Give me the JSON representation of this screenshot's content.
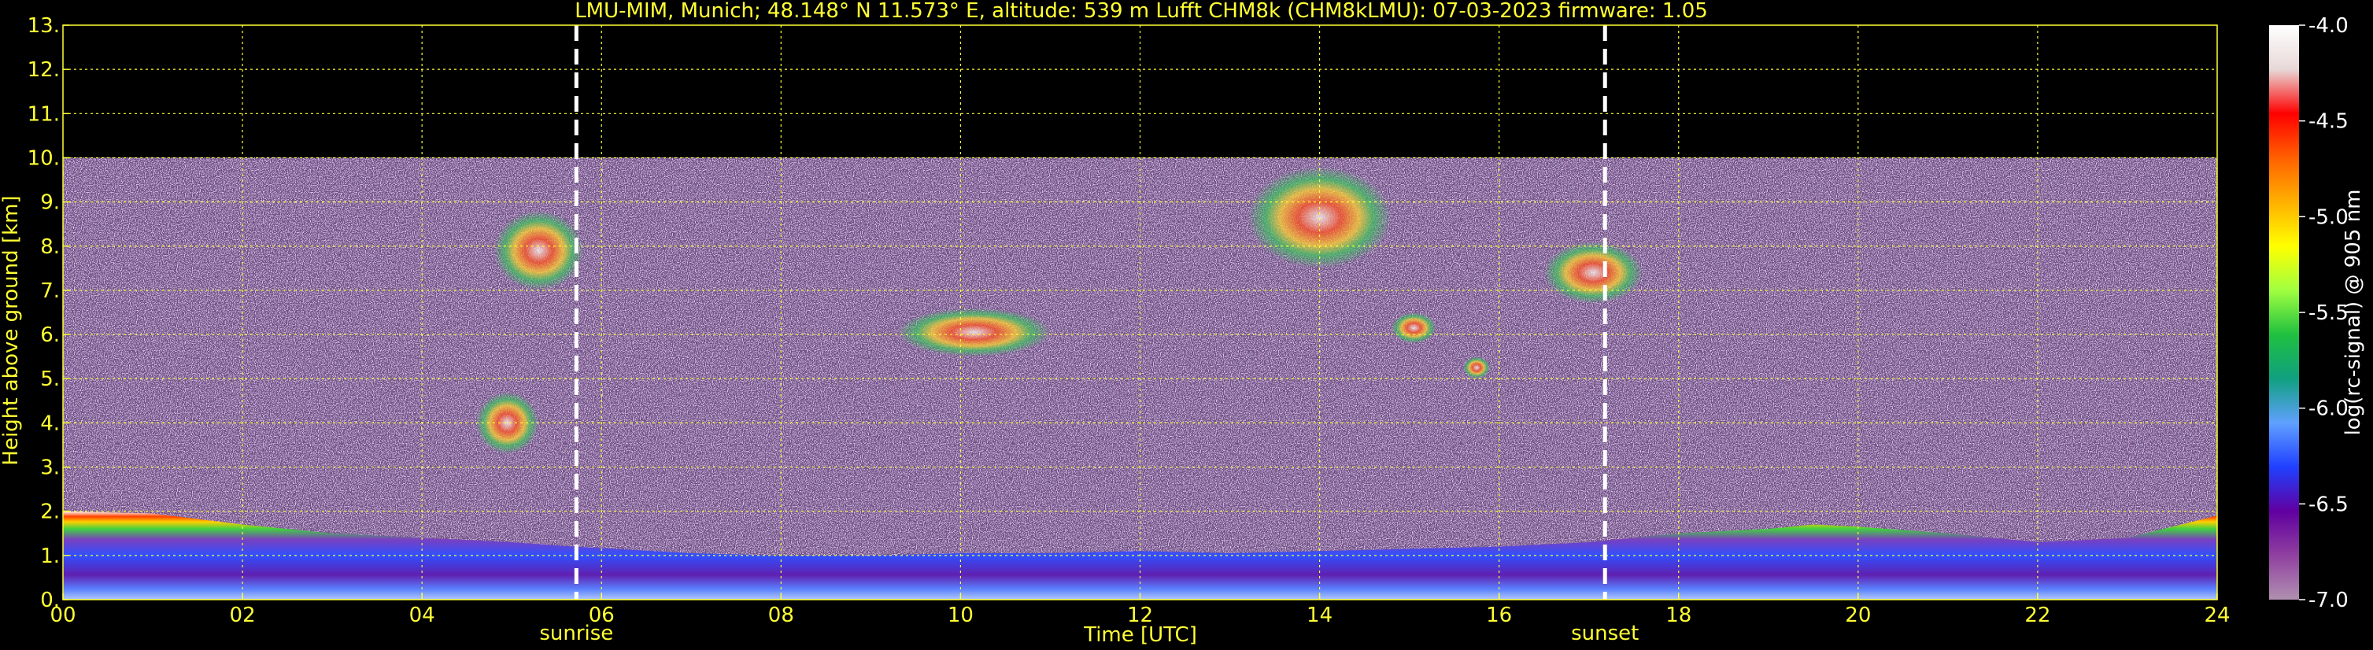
{
  "chart_data": {
    "type": "heatmap",
    "title": "LMU-MIM, Munich; 48.148° N 11.573° E, altitude: 539 m    Lufft CHM8k (CHM8kLMU): 07-03-2023    firmware: 1.05",
    "xlabel": "Time [UTC]",
    "ylabel": "Height above ground [km]",
    "xlim": [
      0,
      24
    ],
    "ylim": [
      0,
      13
    ],
    "x_ticks": [
      "00",
      "02",
      "04",
      "06",
      "08",
      "10",
      "12",
      "14",
      "16",
      "18",
      "20",
      "22",
      "24"
    ],
    "y_ticks": [
      "0.",
      "1.",
      "2.",
      "3.",
      "4.",
      "5.",
      "6.",
      "7.",
      "8.",
      "9.",
      "10.",
      "11.",
      "12.",
      "13."
    ],
    "grid": true,
    "data_top_km": 10,
    "events": [
      {
        "label": "sunrise",
        "time": 5.72
      },
      {
        "label": "sunset",
        "time": 17.18
      }
    ],
    "colorbar": {
      "label": "log(rc-signal) @ 905 nm",
      "range": [
        -7.0,
        -4.0
      ],
      "ticks": [
        "-4.0",
        "-4.5",
        "-5.0",
        "-5.5",
        "-6.0",
        "-6.5",
        "-7.0"
      ],
      "colors": [
        "#ffffff",
        "#e8d8d8",
        "#ff0000",
        "#ff6000",
        "#ffb000",
        "#ffff00",
        "#a0ff40",
        "#20c040",
        "#10a080",
        "#60a0ff",
        "#2040ff",
        "#6000a0",
        "#9040a0",
        "#b090b0"
      ]
    },
    "boundary_layer_top_km": {
      "x": [
        0,
        1,
        2,
        3,
        4,
        5,
        5.7,
        7,
        8,
        9,
        10,
        11,
        12,
        13,
        14,
        15,
        16,
        17,
        18,
        19,
        19.5,
        20,
        21,
        22,
        23,
        24
      ],
      "y": [
        2.0,
        1.95,
        1.7,
        1.5,
        1.4,
        1.3,
        1.2,
        1.05,
        1.0,
        1.0,
        1.05,
        1.05,
        1.1,
        1.05,
        1.1,
        1.15,
        1.2,
        1.3,
        1.5,
        1.6,
        1.7,
        1.65,
        1.5,
        1.3,
        1.4,
        1.9
      ]
    },
    "clouds": [
      {
        "x": [
          4.6,
          5.3
        ],
        "y": [
          3.3,
          4.7
        ]
      },
      {
        "x": [
          4.8,
          5.8
        ],
        "y": [
          7.0,
          8.8
        ]
      },
      {
        "x": [
          9.3,
          11.0
        ],
        "y": [
          5.5,
          6.6
        ]
      },
      {
        "x": [
          13.2,
          14.8
        ],
        "y": [
          7.5,
          9.8
        ]
      },
      {
        "x": [
          14.8,
          15.3
        ],
        "y": [
          5.8,
          6.5
        ]
      },
      {
        "x": [
          15.6,
          15.9
        ],
        "y": [
          5.0,
          5.5
        ]
      },
      {
        "x": [
          16.5,
          17.6
        ],
        "y": [
          6.7,
          8.1
        ]
      }
    ]
  }
}
